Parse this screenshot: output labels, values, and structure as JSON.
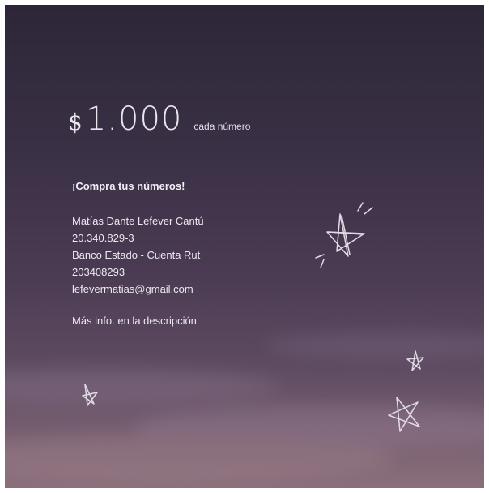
{
  "price": {
    "currency": "$",
    "amount": "1.000",
    "unit_label": "cada número"
  },
  "heading": "¡Compra tus números!",
  "payment_lines": [
    "Matías Dante Lefever Cantú",
    "20.340.829-3",
    "Banco Estado - Cuenta Rut",
    "203408293",
    "lefevermatias@gmail.com"
  ],
  "more_info": "Más info. en la descripción",
  "decorations": {
    "icons": [
      "star-large-icon",
      "star-small-icon",
      "star-medium-icon",
      "star-tiny-icon"
    ],
    "star_color": "#e2dbe6",
    "text_color": "#ece8f0"
  }
}
